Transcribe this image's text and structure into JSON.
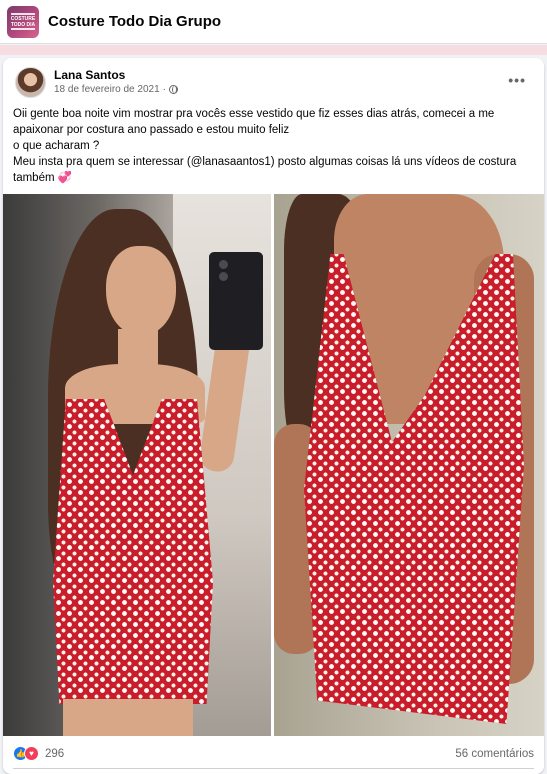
{
  "header": {
    "group_name": "Costure Todo Dia Grupo",
    "logo_text": "COSTURE TODO DIA"
  },
  "post": {
    "author": "Lana Santos",
    "date": "18 de fevereiro de 2021",
    "date_separator": "·",
    "privacy_icon": "globe-icon",
    "more_icon": "more-options-icon",
    "more_label": "•••",
    "text_lines": [
      "Oii gente boa noite vim mostrar pra vocês esse vestido que fiz esses dias atrás, comecei a me apaixonar por costura ano passado e estou muito feliz",
      "o que acharam ?",
      "Meu insta pra quem se interessar (@lanasaantos1) posto algumas coisas lá uns vídeos de costura também 💞"
    ],
    "photos": [
      {
        "name": "mirror-selfie-photo",
        "icon": "photo"
      },
      {
        "name": "dress-closeup-photo",
        "icon": "photo"
      }
    ],
    "reactions": {
      "icons": [
        "like-icon",
        "love-icon"
      ],
      "like_glyph": "👍",
      "love_glyph": "♥",
      "count": "296"
    },
    "comments": "56 comentários"
  },
  "colors": {
    "brand_blue": "#1877f2",
    "love_red": "#f33e58",
    "dress_red": "#c91d2b",
    "secondary_text": "#65676b"
  }
}
